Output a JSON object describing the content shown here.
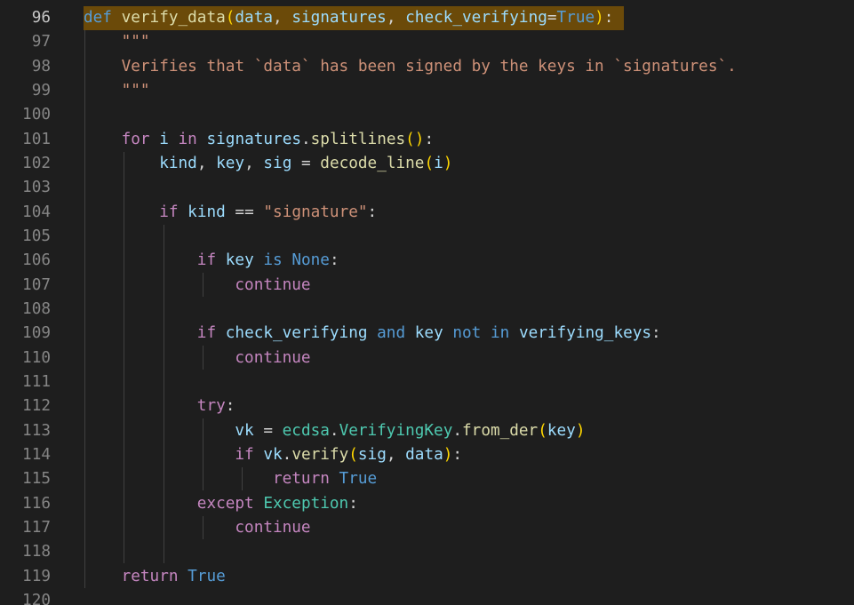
{
  "editor": {
    "language": "python",
    "active_line": "96",
    "lines": [
      {
        "n": "96",
        "tokens": [
          [
            "kw",
            "def"
          ],
          [
            "op",
            " "
          ],
          [
            "fn",
            "verify_data"
          ],
          [
            "br",
            "("
          ],
          [
            "var",
            "data"
          ],
          [
            "op",
            ", "
          ],
          [
            "var",
            "signatures"
          ],
          [
            "op",
            ", "
          ],
          [
            "var",
            "check_verifying"
          ],
          [
            "op",
            "="
          ],
          [
            "kw",
            "True"
          ],
          [
            "br",
            ")"
          ],
          [
            "op",
            ":"
          ]
        ]
      },
      {
        "n": "97",
        "tokens": [
          [
            "op",
            "    "
          ],
          [
            "str",
            "\"\"\""
          ]
        ]
      },
      {
        "n": "98",
        "tokens": [
          [
            "op",
            "    "
          ],
          [
            "str",
            "Verifies that `data` has been signed by the keys in `signatures`."
          ]
        ]
      },
      {
        "n": "99",
        "tokens": [
          [
            "op",
            "    "
          ],
          [
            "str",
            "\"\"\""
          ]
        ]
      },
      {
        "n": "100",
        "tokens": []
      },
      {
        "n": "101",
        "tokens": [
          [
            "op",
            "    "
          ],
          [
            "ctl",
            "for"
          ],
          [
            "op",
            " "
          ],
          [
            "var",
            "i"
          ],
          [
            "op",
            " "
          ],
          [
            "ctl",
            "in"
          ],
          [
            "op",
            " "
          ],
          [
            "var",
            "signatures"
          ],
          [
            "op",
            "."
          ],
          [
            "fn",
            "splitlines"
          ],
          [
            "br",
            "()"
          ],
          [
            "op",
            ":"
          ]
        ]
      },
      {
        "n": "102",
        "tokens": [
          [
            "op",
            "        "
          ],
          [
            "var",
            "kind"
          ],
          [
            "op",
            ", "
          ],
          [
            "var",
            "key"
          ],
          [
            "op",
            ", "
          ],
          [
            "var",
            "sig"
          ],
          [
            "op",
            " = "
          ],
          [
            "fn",
            "decode_line"
          ],
          [
            "br",
            "("
          ],
          [
            "var",
            "i"
          ],
          [
            "br",
            ")"
          ]
        ]
      },
      {
        "n": "103",
        "tokens": []
      },
      {
        "n": "104",
        "tokens": [
          [
            "op",
            "        "
          ],
          [
            "ctl",
            "if"
          ],
          [
            "op",
            " "
          ],
          [
            "var",
            "kind"
          ],
          [
            "op",
            " == "
          ],
          [
            "str",
            "\"signature\""
          ],
          [
            "op",
            ":"
          ]
        ]
      },
      {
        "n": "105",
        "tokens": []
      },
      {
        "n": "106",
        "tokens": [
          [
            "op",
            "            "
          ],
          [
            "ctl",
            "if"
          ],
          [
            "op",
            " "
          ],
          [
            "var",
            "key"
          ],
          [
            "op",
            " "
          ],
          [
            "kw",
            "is"
          ],
          [
            "op",
            " "
          ],
          [
            "kw",
            "None"
          ],
          [
            "op",
            ":"
          ]
        ]
      },
      {
        "n": "107",
        "tokens": [
          [
            "op",
            "                "
          ],
          [
            "ctl",
            "continue"
          ]
        ]
      },
      {
        "n": "108",
        "tokens": []
      },
      {
        "n": "109",
        "tokens": [
          [
            "op",
            "            "
          ],
          [
            "ctl",
            "if"
          ],
          [
            "op",
            " "
          ],
          [
            "var",
            "check_verifying"
          ],
          [
            "op",
            " "
          ],
          [
            "kw",
            "and"
          ],
          [
            "op",
            " "
          ],
          [
            "var",
            "key"
          ],
          [
            "op",
            " "
          ],
          [
            "kw",
            "not"
          ],
          [
            "op",
            " "
          ],
          [
            "kw",
            "in"
          ],
          [
            "op",
            " "
          ],
          [
            "var",
            "verifying_keys"
          ],
          [
            "op",
            ":"
          ]
        ]
      },
      {
        "n": "110",
        "tokens": [
          [
            "op",
            "                "
          ],
          [
            "ctl",
            "continue"
          ]
        ]
      },
      {
        "n": "111",
        "tokens": []
      },
      {
        "n": "112",
        "tokens": [
          [
            "op",
            "            "
          ],
          [
            "ctl",
            "try"
          ],
          [
            "op",
            ":"
          ]
        ]
      },
      {
        "n": "113",
        "tokens": [
          [
            "op",
            "                "
          ],
          [
            "var",
            "vk"
          ],
          [
            "op",
            " = "
          ],
          [
            "cls",
            "ecdsa"
          ],
          [
            "op",
            "."
          ],
          [
            "cls",
            "VerifyingKey"
          ],
          [
            "op",
            "."
          ],
          [
            "fn",
            "from_der"
          ],
          [
            "br",
            "("
          ],
          [
            "var",
            "key"
          ],
          [
            "br",
            ")"
          ]
        ]
      },
      {
        "n": "114",
        "tokens": [
          [
            "op",
            "                "
          ],
          [
            "ctl",
            "if"
          ],
          [
            "op",
            " "
          ],
          [
            "var",
            "vk"
          ],
          [
            "op",
            "."
          ],
          [
            "fn",
            "verify"
          ],
          [
            "br",
            "("
          ],
          [
            "var",
            "sig"
          ],
          [
            "op",
            ", "
          ],
          [
            "var",
            "data"
          ],
          [
            "br",
            ")"
          ],
          [
            "op",
            ":"
          ]
        ]
      },
      {
        "n": "115",
        "tokens": [
          [
            "op",
            "                    "
          ],
          [
            "ctl",
            "return"
          ],
          [
            "op",
            " "
          ],
          [
            "kw",
            "True"
          ]
        ]
      },
      {
        "n": "116",
        "tokens": [
          [
            "op",
            "            "
          ],
          [
            "ctl",
            "except"
          ],
          [
            "op",
            " "
          ],
          [
            "cls",
            "Exception"
          ],
          [
            "op",
            ":"
          ]
        ]
      },
      {
        "n": "117",
        "tokens": [
          [
            "op",
            "                "
          ],
          [
            "ctl",
            "continue"
          ]
        ]
      },
      {
        "n": "118",
        "tokens": []
      },
      {
        "n": "119",
        "tokens": [
          [
            "op",
            "    "
          ],
          [
            "ctl",
            "return"
          ],
          [
            "op",
            " "
          ],
          [
            "kw",
            "True"
          ]
        ]
      },
      {
        "n": "120",
        "tokens": []
      }
    ],
    "colors": {
      "background": "#1e1e1e",
      "highlight": "#6b4a09",
      "keyword": "#569cd6",
      "control": "#c586c0",
      "function": "#dcdcaa",
      "variable": "#9cdcfe",
      "string": "#ce9178",
      "class": "#4ec9b0",
      "bracket": "#ffd700"
    }
  }
}
